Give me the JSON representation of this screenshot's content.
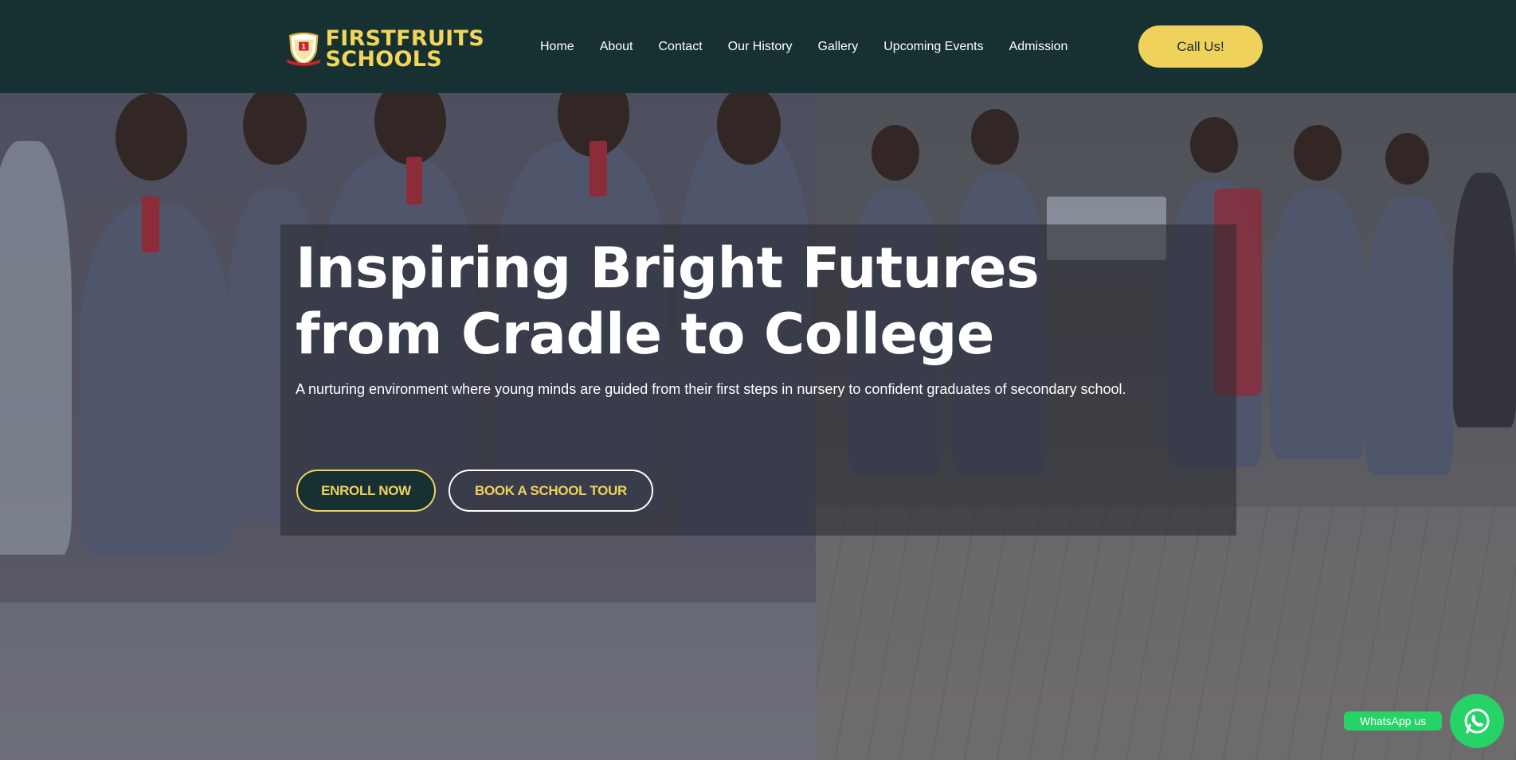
{
  "brand": {
    "name_line1": "FIRSTFRUITS",
    "name_line2": "SCHOOLS",
    "accent_color": "#efd25b",
    "header_bg": "#173133"
  },
  "nav": {
    "items": [
      {
        "label": "Home"
      },
      {
        "label": "About"
      },
      {
        "label": "Contact"
      },
      {
        "label": "Our History"
      },
      {
        "label": "Gallery"
      },
      {
        "label": "Upcoming Events"
      },
      {
        "label": "Admission"
      }
    ],
    "cta_label": "Call Us!"
  },
  "hero": {
    "title_line1": "Inspiring Bright Futures",
    "title_line2": "from Cradle to College",
    "subtitle": "A nurturing environment where young minds are guided from their first steps in nursery to confident graduates of secondary school.",
    "primary_button": "ENROLL NOW",
    "secondary_button": "BOOK A SCHOOL TOUR"
  },
  "whatsapp": {
    "label": "WhatsApp us",
    "icon": "whatsapp-icon",
    "color": "#25d366"
  }
}
